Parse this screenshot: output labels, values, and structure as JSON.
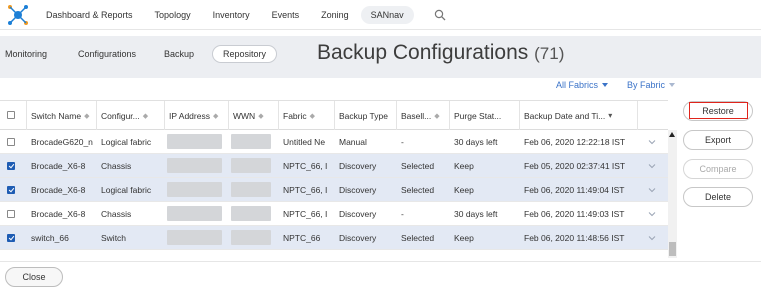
{
  "topnav": {
    "items": [
      "Dashboard & Reports",
      "Topology",
      "Inventory",
      "Events",
      "Zoning",
      "SANnav"
    ],
    "active": "SANnav"
  },
  "subtabs": [
    "Monitoring",
    "Configurations",
    "Backup",
    "Repository"
  ],
  "active_subtab": "Repository",
  "page": {
    "title": "Backup Configurations",
    "count": "(71)"
  },
  "filters": {
    "fabric": "All Fabrics",
    "group": "By Fabric"
  },
  "table": {
    "columns": [
      "Switch Name",
      "Configur...",
      "IP Address",
      "WWN",
      "Fabric",
      "Backup Type",
      "Basell...",
      "Purge Stat...",
      "Backup Date and Ti..."
    ],
    "rows": [
      {
        "checked": false,
        "selected": false,
        "switch": "BrocadeG620_n",
        "config": "Logical fabric",
        "fabric": "Untitled Ne",
        "type": "Manual",
        "baseline": "-",
        "purge": "30 days left",
        "date": "Feb 06, 2020 12:22:18 IST"
      },
      {
        "checked": true,
        "selected": true,
        "switch": "Brocade_X6-8",
        "config": "Chassis",
        "fabric": "NPTC_66, I",
        "type": "Discovery",
        "baseline": "Selected",
        "purge": "Keep",
        "date": "Feb 05, 2020 02:37:41 IST"
      },
      {
        "checked": true,
        "selected": true,
        "switch": "Brocade_X6-8",
        "config": "Logical fabric",
        "fabric": "NPTC_66, I",
        "type": "Discovery",
        "baseline": "Selected",
        "purge": "Keep",
        "date": "Feb 06, 2020 11:49:04 IST"
      },
      {
        "checked": false,
        "selected": false,
        "switch": "Brocade_X6-8",
        "config": "Chassis",
        "fabric": "NPTC_66, I",
        "type": "Discovery",
        "baseline": "-",
        "purge": "30 days left",
        "date": "Feb 06, 2020 11:49:03 IST"
      },
      {
        "checked": true,
        "selected": true,
        "switch": "switch_66",
        "config": "Switch",
        "fabric": "NPTC_66",
        "type": "Discovery",
        "baseline": "Selected",
        "purge": "Keep",
        "date": "Feb 06, 2020 11:48:56 IST"
      }
    ]
  },
  "actions": {
    "restore": "Restore",
    "export": "Export",
    "compare": "Compare",
    "delete": "Delete"
  },
  "close_label": "Close",
  "colors": {
    "accent": "#3b73c8",
    "selected_row": "#e3e9f4",
    "highlight": "#e0241b",
    "checkbox": "#1e5cb3"
  }
}
